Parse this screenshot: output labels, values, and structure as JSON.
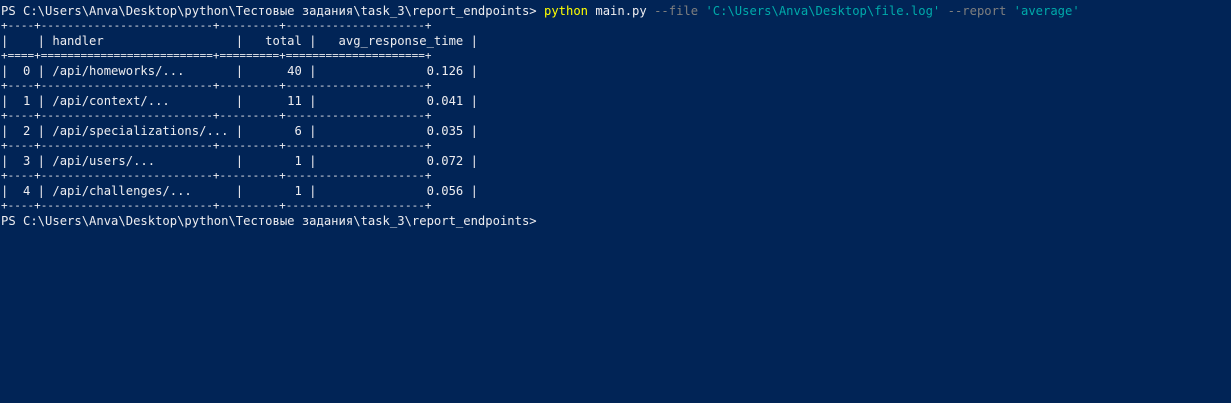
{
  "prompt": "PS C:\\Users\\Anva\\Desktop\\python\\Тестовые задания\\task_3\\report_endpoints>",
  "command": {
    "exe": "python",
    "arg": "main.py",
    "flag_file": "--file",
    "file_value": "'C:\\Users\\Anva\\Desktop\\file.log'",
    "flag_report": "--report",
    "report_value": "'average'"
  },
  "table": {
    "border_top": "+----+--------------------------+---------+---------------------+",
    "header": "|    | handler                  |   total |   avg_response_time |",
    "header_sep": "+====+==========================+=========+=====================+",
    "row_sep": "+----+--------------------------+---------+---------------------+",
    "rows": [
      "|  0 | /api/homeworks/...       |      40 |               0.126 |",
      "|  1 | /api/context/...         |      11 |               0.041 |",
      "|  2 | /api/specializations/... |       6 |               0.035 |",
      "|  3 | /api/users/...           |       1 |               0.072 |",
      "|  4 | /api/challenges/...      |       1 |               0.056 |"
    ],
    "columns": [
      "",
      "handler",
      "total",
      "avg_response_time"
    ],
    "data": [
      {
        "index": "0",
        "handler": "/api/homeworks/...",
        "total": "40",
        "avg_response_time": "0.126"
      },
      {
        "index": "1",
        "handler": "/api/context/...",
        "total": "11",
        "avg_response_time": "0.041"
      },
      {
        "index": "2",
        "handler": "/api/specializations/...",
        "total": "6",
        "avg_response_time": "0.035"
      },
      {
        "index": "3",
        "handler": "/api/users/...",
        "total": "1",
        "avg_response_time": "0.072"
      },
      {
        "index": "4",
        "handler": "/api/challenges/...",
        "total": "1",
        "avg_response_time": "0.056"
      }
    ]
  },
  "colors": {
    "background": "#012456",
    "text": "#eeedf0",
    "command": "#ffff00",
    "parameter": "#7f7f7f",
    "string": "#00aaaa"
  }
}
